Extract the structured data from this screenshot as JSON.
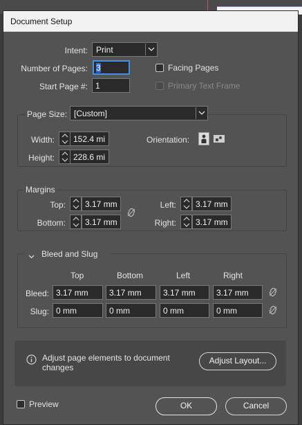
{
  "dialog": {
    "title": "Document Setup"
  },
  "intent": {
    "label": "Intent:",
    "value": "Print"
  },
  "pages": {
    "number_label": "Number of Pages:",
    "number_value_selected": "3",
    "start_label": "Start Page #:",
    "start_value": "1",
    "facing_pages_label": "Facing Pages",
    "facing_pages_checked": false,
    "primary_text_frame_label": "Primary Text Frame",
    "primary_text_frame_checked": false
  },
  "page_size": {
    "label": "Page Size:",
    "value": "[Custom]",
    "width_label": "Width:",
    "width_value": "152.4 mi",
    "height_label": "Height:",
    "height_value": "228.6 mi",
    "orientation_label": "Orientation:",
    "orientation_selected": "portrait"
  },
  "margins": {
    "title": "Margins",
    "top_label": "Top:",
    "top_value": "3.17 mm",
    "bottom_label": "Bottom:",
    "bottom_value": "3.17 mm",
    "left_label": "Left:",
    "left_value": "3.17 mm",
    "right_label": "Right:",
    "right_value": "3.17 mm"
  },
  "bleed_slug": {
    "title": "Bleed and Slug",
    "columns": [
      "Top",
      "Bottom",
      "Left",
      "Right"
    ],
    "bleed_label": "Bleed:",
    "bleed_values": [
      "3.17 mm",
      "3.17 mm",
      "3.17 mm",
      "3.17 mm"
    ],
    "slug_label": "Slug:",
    "slug_values": [
      "0 mm",
      "0 mm",
      "0 mm",
      "0 mm"
    ]
  },
  "adjust": {
    "message": "Adjust page elements to document changes",
    "message_line1": "Adjust page elements to document",
    "message_line2": "changes",
    "button_label": "Adjust Layout..."
  },
  "footer": {
    "preview_label": "Preview",
    "preview_checked": false,
    "ok_label": "OK",
    "cancel_label": "Cancel"
  }
}
